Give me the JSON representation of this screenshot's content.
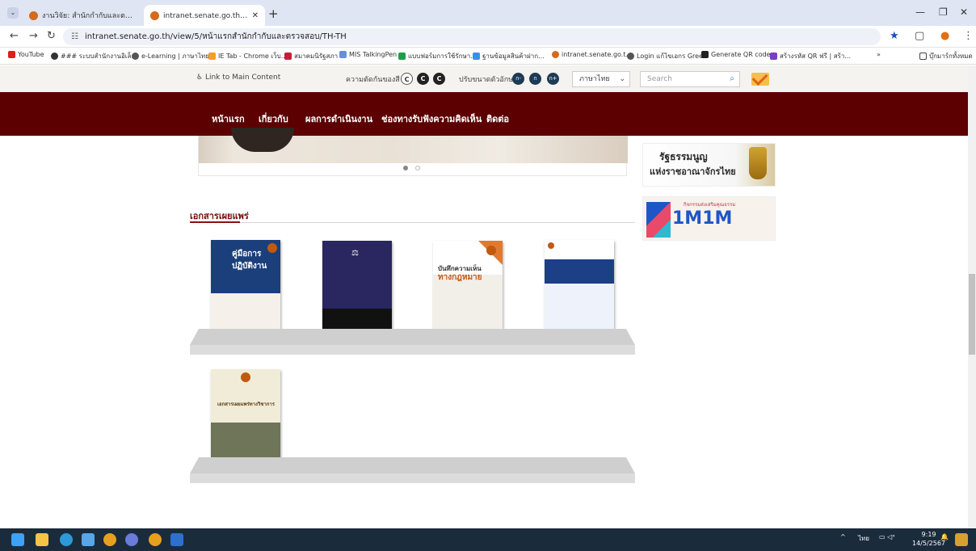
{
  "browser": {
    "tabs": [
      {
        "title": "งานวิจัย: สำนักกำกับและตรวจสอบ ×",
        "active": false
      },
      {
        "title": "intranet.senate.go.th/view/5/หน้า",
        "active": true
      }
    ],
    "url_display": "intranet.senate.go.th/view/5/หน้าแรกสำนักกำกับและตรวจสอบ/TH-TH",
    "bookmarks": [
      "YouTube",
      "### ระบบสำนักงานอิเล็...",
      "e-Learning | ภาษาไทย...",
      "IE Tab - Chrome เว็บ...",
      "สมาคมนิรัฐสภา",
      "MIS TalkingPen",
      "แบบฟอร์มการใช้รักษา...",
      "ฐานข้อมูลสินค้าฝาก...",
      "intranet.senate.go.t...",
      "Login แก้ไขเอกร Green",
      "Generate QR code",
      "สร้างรหัส QR ฟรี | สร้า...",
      "บุ๊กมาร์กทั้งหมด"
    ],
    "bookmarks_overflow": "»"
  },
  "accessibility": {
    "link_main": "Link to Main Content",
    "contrast_label": "ความตัดกันของสี",
    "contrast_buttons": [
      "C",
      "C",
      "C"
    ],
    "font_label": "ปรับขนาดตัวอักษร",
    "font_buttons": [
      "ก-",
      "ก",
      "ก+"
    ],
    "language": "ภาษาไทย",
    "search_placeholder": "Search"
  },
  "main_nav": [
    "หน้าแรก",
    "เกี่ยวกับ",
    "ผลการดำเนินงาน",
    "ช่องทางรับฟังความคิดเห็น",
    "ติดต่อ"
  ],
  "side_banners": {
    "constitution_line1": "รัฐธรรมนูญ",
    "constitution_line2": "แห่งราชอาณาจักรไทย",
    "moral_big": "1M1M",
    "moral_small": "กิจกรรมส่งเสริมคุณธรรม"
  },
  "section": {
    "title": "เอกสารเผยแพร่"
  },
  "books": [
    {
      "title": "คู่มือการปฏิบัติงาน"
    },
    {
      "title": ""
    },
    {
      "title": "บันทึกความเห็น",
      "subtitle": "ทางกฎหมาย"
    },
    {
      "title": ""
    },
    {
      "title": "เอกสารเผยแพร่ทางวิชาการ"
    }
  ],
  "taskbar": {
    "lang": "ไทย",
    "time": "9:19",
    "date": "14/5/2567"
  },
  "colors": {
    "nav_bg": "#5c0002",
    "section_title": "#7a0a0a",
    "taskbar_bg": "#1a2b3c"
  }
}
